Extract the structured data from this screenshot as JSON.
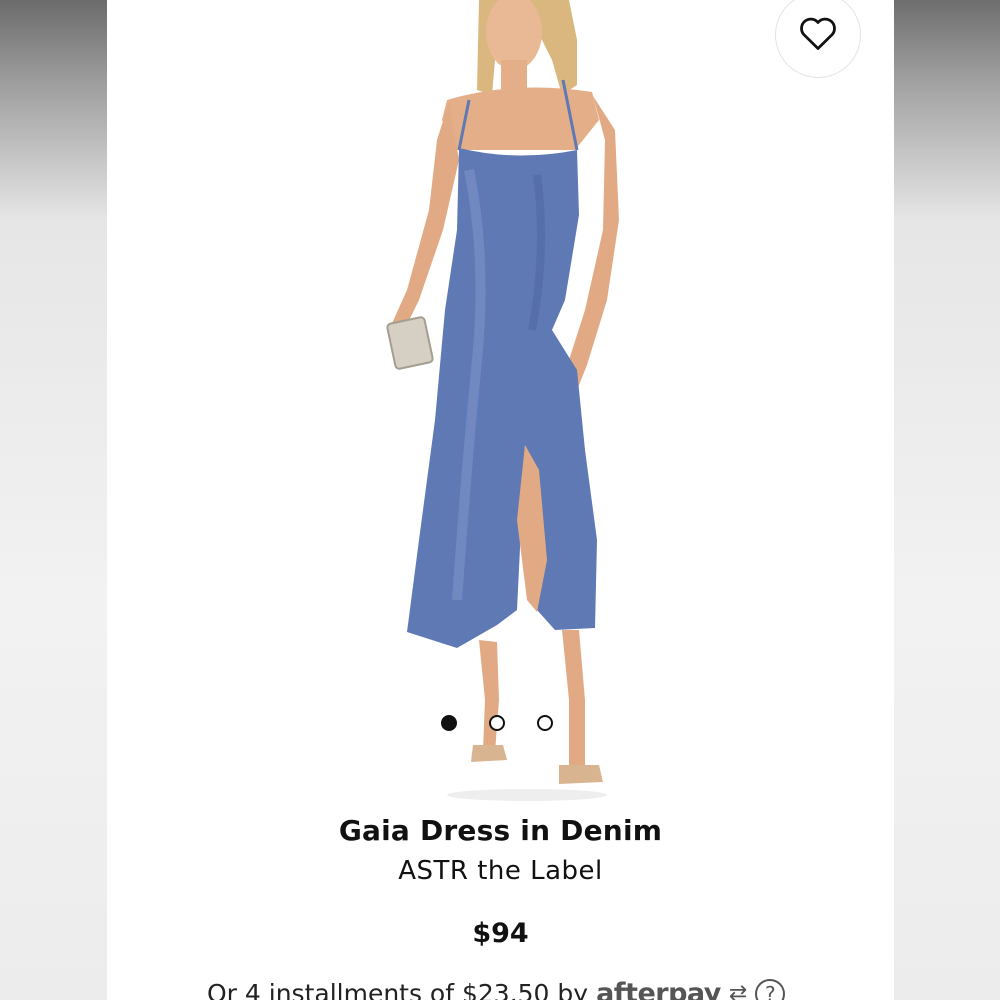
{
  "product": {
    "title": "Gaia Dress in Denim",
    "brand": "ASTR the Label",
    "price": "$94",
    "image_alt": "Model wearing blue satin slip dress",
    "dress_color": "#5f79b4"
  },
  "gallery": {
    "total_images": 3,
    "active_index": 0
  },
  "wishlist": {
    "icon": "heart-icon"
  },
  "payment": {
    "installment_text": "Or 4 installments of $23.50 by",
    "provider": "afterpay",
    "help_icon": "?"
  }
}
